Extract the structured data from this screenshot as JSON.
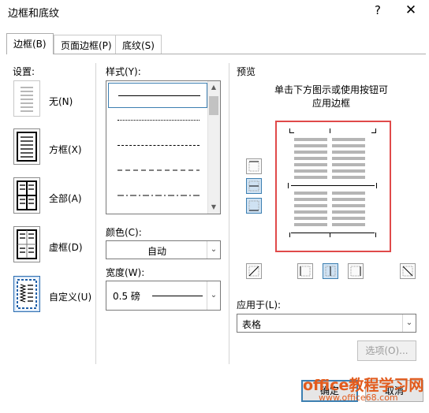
{
  "window": {
    "title": "边框和底纹",
    "help_label": "?",
    "close_label": "✕"
  },
  "tabs": [
    {
      "label": "边框(B)",
      "active": true
    },
    {
      "label": "页面边框(P)",
      "active": false
    },
    {
      "label": "底纹(S)",
      "active": false
    }
  ],
  "settings": {
    "label": "设置:",
    "presets": [
      {
        "label": "无(N)",
        "icon": "border-none-icon"
      },
      {
        "label": "方框(X)",
        "icon": "border-box-icon"
      },
      {
        "label": "全部(A)",
        "icon": "border-all-icon"
      },
      {
        "label": "虚框(D)",
        "icon": "border-grid-icon"
      },
      {
        "label": "自定义(U)",
        "icon": "border-custom-icon",
        "selected": true
      }
    ]
  },
  "style": {
    "label": "样式(Y):",
    "items": [
      "solid",
      "dotted",
      "dashed-small",
      "dashed-large",
      "dash-dot"
    ],
    "selected_index": 0
  },
  "color": {
    "label": "颜色(C):",
    "value": "自动"
  },
  "width": {
    "label": "宽度(W):",
    "value": "0.5 磅"
  },
  "preview": {
    "label": "预览",
    "hint_line1": "单击下方图示或使用按钮可",
    "hint_line2": "应用边框",
    "highlight_color": "#e04a4a"
  },
  "apply_to": {
    "label": "应用于(L):",
    "value": "表格"
  },
  "buttons": {
    "options": "选项(O)...",
    "ok": "确定",
    "cancel": "取消"
  },
  "watermark": {
    "line1": "office教程学习网",
    "line2": "www.office68.com"
  }
}
